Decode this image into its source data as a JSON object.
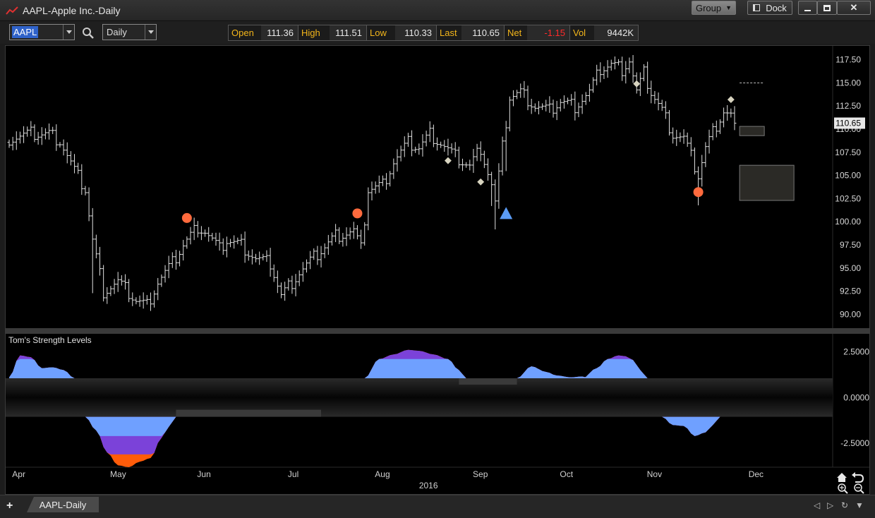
{
  "window": {
    "title": "AAPL-Apple Inc.-Daily"
  },
  "titlebar_buttons": {
    "group": "Group",
    "dock": "Dock",
    "minimize": "▁",
    "maximize": "▢",
    "close": "✕"
  },
  "toolbar": {
    "symbol": "AAPL",
    "interval": "Daily",
    "quote": [
      {
        "label": "Open",
        "value": "111.36"
      },
      {
        "label": "High",
        "value": "111.51"
      },
      {
        "label": "Low",
        "value": "110.33"
      },
      {
        "label": "Last",
        "value": "110.65"
      },
      {
        "label": "Net",
        "value": "-1.15"
      },
      {
        "label": "Vol",
        "value": "9442K"
      }
    ],
    "net_color": "#ff2a2a",
    "label_color": "#f3b51b"
  },
  "tabs": {
    "add": "+",
    "items": [
      "AAPL-Daily"
    ]
  },
  "chart_data": [
    {
      "type": "ohlc",
      "price_axis": {
        "ticks": [
          "117.50",
          "115.00",
          "112.50",
          "110.00",
          "107.50",
          "105.00",
          "102.50",
          "100.00",
          "97.50",
          "95.00",
          "92.50",
          "90.00"
        ],
        "ylim": [
          88.5,
          119
        ]
      },
      "last_price_label": "110.65",
      "months": [
        "Apr",
        "May",
        "Jun",
        "Jul",
        "Aug",
        "Sep",
        "Oct",
        "Nov",
        "Dec"
      ],
      "year_label": "2016",
      "close_anchors": [
        [
          0,
          109.0
        ],
        [
          6,
          109.5
        ],
        [
          11,
          109.5
        ],
        [
          14,
          108.8
        ],
        [
          18,
          105.5
        ],
        [
          21,
          103.5
        ],
        [
          23,
          98
        ],
        [
          26,
          92.5
        ],
        [
          30,
          93.5
        ],
        [
          35,
          91.5
        ],
        [
          38,
          91
        ],
        [
          41,
          93.5
        ],
        [
          45,
          95.5
        ],
        [
          48,
          97.5
        ],
        [
          52,
          99.5
        ],
        [
          54,
          99
        ],
        [
          58,
          97
        ],
        [
          60,
          98
        ],
        [
          64,
          97.5
        ],
        [
          68,
          96
        ],
        [
          72,
          95.5
        ],
        [
          75,
          92
        ],
        [
          80,
          94.5
        ],
        [
          85,
          96.5
        ],
        [
          90,
          98.5
        ],
        [
          95,
          99
        ],
        [
          97,
          97
        ],
        [
          99,
          103.5
        ],
        [
          103,
          104
        ],
        [
          106,
          106.5
        ],
        [
          110,
          108.5
        ],
        [
          113,
          108
        ],
        [
          116,
          109.5
        ],
        [
          119,
          108.5
        ],
        [
          123,
          107
        ],
        [
          127,
          106
        ],
        [
          130,
          108
        ],
        [
          133,
          104
        ],
        [
          134,
          102
        ],
        [
          136,
          108
        ],
        [
          138,
          113.5
        ],
        [
          141,
          114
        ],
        [
          145,
          112.5
        ],
        [
          149,
          112
        ],
        [
          152,
          113
        ],
        [
          156,
          112.5
        ],
        [
          160,
          114
        ],
        [
          163,
          116.5
        ],
        [
          166,
          117
        ],
        [
          169,
          116.5
        ],
        [
          171,
          117.5
        ],
        [
          173,
          114
        ],
        [
          175,
          116
        ],
        [
          177,
          114
        ],
        [
          180,
          112
        ],
        [
          183,
          109.5
        ],
        [
          186,
          109
        ],
        [
          188,
          107
        ],
        [
          190,
          105
        ],
        [
          192,
          108
        ],
        [
          195,
          110.5
        ],
        [
          197,
          112
        ],
        [
          199,
          111.5
        ],
        [
          200,
          110.65
        ]
      ],
      "drops": [
        [
          23,
          5.0
        ],
        [
          133,
          2.0
        ],
        [
          134,
          2.5
        ],
        [
          137,
          2.5
        ],
        [
          190,
          2.3
        ]
      ],
      "markers": [
        {
          "shape": "circle",
          "idx": 49,
          "price": 100.4,
          "color": "#ff6a3d"
        },
        {
          "shape": "circle",
          "idx": 96,
          "price": 100.9,
          "color": "#ff6a3d"
        },
        {
          "shape": "circle",
          "idx": 190,
          "price": 103.2,
          "color": "#ff6a3d"
        },
        {
          "shape": "diamond",
          "idx": 121,
          "price": 106.6,
          "color": "#d8d4c0"
        },
        {
          "shape": "diamond",
          "idx": 130,
          "price": 104.3,
          "color": "#d8d4c0"
        },
        {
          "shape": "diamond",
          "idx": 173,
          "price": 114.9,
          "color": "#d8d4c0"
        },
        {
          "shape": "diamond",
          "idx": 199,
          "price": 113.2,
          "color": "#d8d4c0"
        },
        {
          "shape": "triangle",
          "idx": 137,
          "price": 100.9,
          "color": "#5b9cf5"
        }
      ],
      "projection": {
        "dashed_level": 115.0,
        "small_box": [
          109.3,
          110.3
        ],
        "large_box": [
          102.3,
          106.1
        ],
        "box_color": "#2b2a26"
      }
    },
    {
      "type": "area",
      "title": "Tom's Strength Levels",
      "ticks": [
        "2.5000",
        "0.0000",
        "-2.5000"
      ],
      "ylim": [
        -3.8,
        3.4
      ],
      "band": [
        -1.05,
        1.05
      ],
      "colors": {
        "base": "#6fa0ff",
        "mid": "#7b42d9",
        "top": "#ff5c0a"
      },
      "upper_segments": [
        {
          "idx": [
            0,
            3,
            6,
            9,
            12,
            15,
            18,
            20
          ],
          "vals": [
            1.1,
            2.3,
            2.2,
            1.6,
            1.65,
            1.5,
            1.05,
            1.05
          ]
        },
        {
          "idx": [
            98,
            102,
            106,
            110,
            113,
            117,
            121,
            124,
            126
          ],
          "vals": [
            1.05,
            2.1,
            2.35,
            2.6,
            2.55,
            2.35,
            2.1,
            1.5,
            1.05
          ]
        },
        {
          "idx": [
            140,
            144,
            148,
            151,
            155,
            158,
            160
          ],
          "vals": [
            1.05,
            1.7,
            1.4,
            1.2,
            1.1,
            1.15,
            1.05
          ]
        },
        {
          "idx": [
            158,
            162,
            165,
            168,
            170,
            172,
            174,
            176
          ],
          "vals": [
            1.05,
            1.6,
            2.1,
            2.3,
            2.25,
            2.05,
            1.5,
            1.05
          ]
        }
      ],
      "lower_segments": [
        {
          "idx": [
            21,
            24,
            27,
            30,
            33,
            36,
            39,
            42,
            44,
            46
          ],
          "vals": [
            -1.05,
            -1.8,
            -3.0,
            -3.7,
            -3.8,
            -3.5,
            -3.3,
            -2.2,
            -1.6,
            -1.05
          ]
        },
        {
          "idx": [
            180,
            183,
            186,
            189,
            192,
            194,
            196
          ],
          "vals": [
            -1.05,
            -1.5,
            -1.55,
            -2.1,
            -1.9,
            -1.5,
            -1.05
          ]
        }
      ],
      "band_slots": [
        [
          46,
          86
        ],
        [
          124,
          140
        ]
      ]
    }
  ]
}
